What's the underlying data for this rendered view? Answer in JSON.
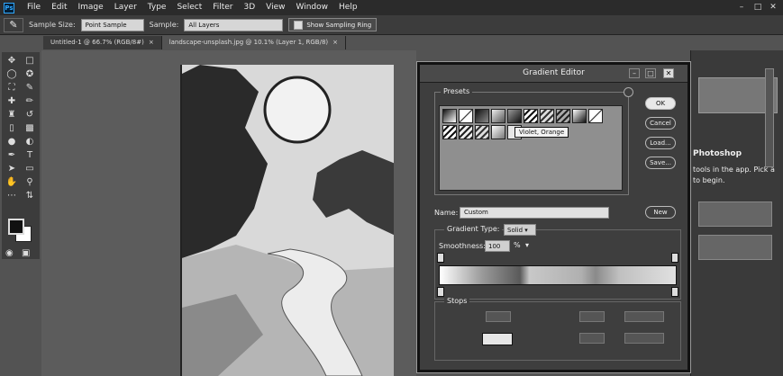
{
  "menu": {
    "items": [
      "File",
      "Edit",
      "Image",
      "Layer",
      "Type",
      "Select",
      "Filter",
      "3D",
      "View",
      "Window",
      "Help"
    ]
  },
  "options_bar": {
    "sample_size_label": "Sample Size:",
    "sample_size_value": "Point Sample",
    "sample_label": "Sample:",
    "sample_value": "All Layers",
    "show_ring_label": "Show Sampling Ring"
  },
  "tabs": [
    {
      "label": "Untitled-1 @ 66.7% (RGB/8#)"
    },
    {
      "label": "landscape-unsplash.jpg @ 10.1% (Layer 1, RGB/8)"
    }
  ],
  "dialog": {
    "title": "Gradient Editor",
    "presets_label": "Presets",
    "preset_tooltip": "Violet, Orange",
    "buttons": {
      "ok": "OK",
      "cancel": "Cancel",
      "load": "Load...",
      "save": "Save..."
    },
    "name_label": "Name:",
    "name_value": "Custom",
    "new_button": "New",
    "gradient_type_label": "Gradient Type:",
    "gradient_type_value": "Solid",
    "smoothness_label": "Smoothness:",
    "smoothness_value": "100",
    "smoothness_unit": "%",
    "stops_label": "Stops"
  },
  "right_panel": {
    "heading": "Photoshop",
    "line1": "tools in the app. Pick a",
    "line2": "to begin."
  },
  "colors": {
    "app_bg": "#535353",
    "dialog_bg": "#3e3e3e",
    "accent": "#31a8ff"
  }
}
